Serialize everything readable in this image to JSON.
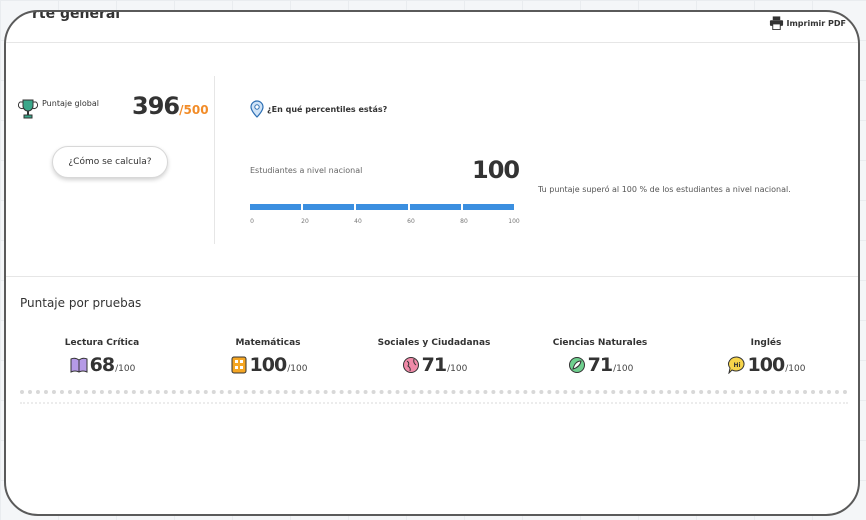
{
  "header": {
    "title": "rte general",
    "print_label": "Imprimir PDF"
  },
  "global": {
    "label": "Puntaje global",
    "score": "396",
    "max": "/500",
    "calc_button": "¿Cómo se calcula?"
  },
  "percentile": {
    "title": "¿En qué percentiles estás?",
    "national_label": "Estudiantes a nivel nacional",
    "national_value": "100",
    "progress_fraction": 1.0,
    "ticks": [
      "0",
      "20",
      "40",
      "60",
      "80",
      "100"
    ],
    "summary": "Tu puntaje superó al 100 % de los estudiantes a nivel nacional."
  },
  "tests": {
    "section_title": "Puntaje por pruebas",
    "items": [
      {
        "name": "Lectura Crítica",
        "score": "68",
        "max": "/100",
        "icon": "book-icon"
      },
      {
        "name": "Matemáticas",
        "score": "100",
        "max": "/100",
        "icon": "calculator-icon"
      },
      {
        "name": "Sociales y Ciudadanas",
        "score": "71",
        "max": "/100",
        "icon": "globe-icon"
      },
      {
        "name": "Ciencias Naturales",
        "score": "71",
        "max": "/100",
        "icon": "leaf-icon"
      },
      {
        "name": "Inglés",
        "score": "100",
        "max": "/100",
        "icon": "speech-bubble-icon"
      }
    ]
  },
  "colors": {
    "accent_orange": "#f28c28",
    "bar_blue": "#3b8fe0"
  }
}
